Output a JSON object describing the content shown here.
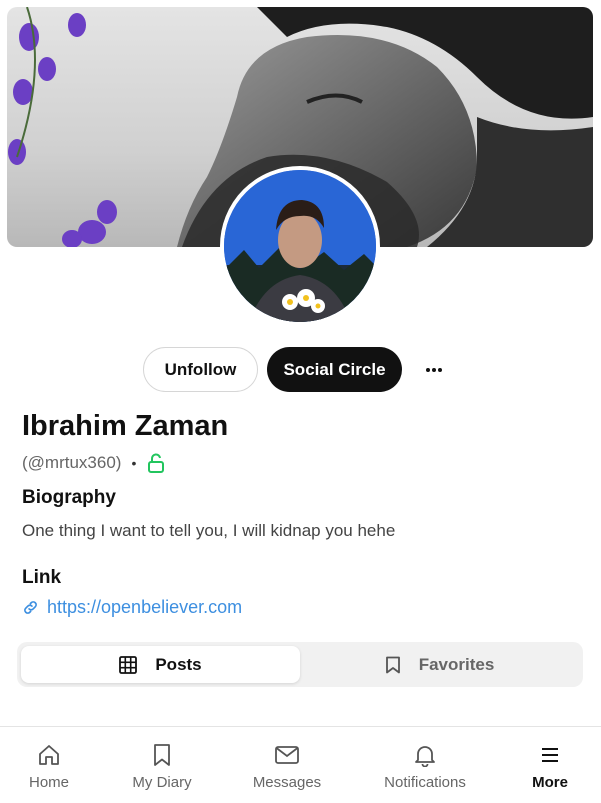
{
  "profile": {
    "name": "Ibrahim Zaman",
    "handle": "(@mrtux360)",
    "separator": "•",
    "bio_label": "Biography",
    "bio": "One thing I want to tell you, I will kidnap you hehe",
    "link_label": "Link",
    "link": "https://openbeliever.com"
  },
  "actions": {
    "unfollow": "Unfollow",
    "social_circle": "Social Circle",
    "more_icon": "ellipsis-icon"
  },
  "tabs": [
    {
      "label": "Posts",
      "icon": "grid-icon",
      "active": true
    },
    {
      "label": "Favorites",
      "icon": "bookmark-icon",
      "active": false
    }
  ],
  "nav": [
    {
      "label": "Home",
      "icon": "home-icon"
    },
    {
      "label": "My Diary",
      "icon": "bookmark-icon"
    },
    {
      "label": "Messages",
      "icon": "mail-icon"
    },
    {
      "label": "Notifications",
      "icon": "bell-icon"
    },
    {
      "label": "More",
      "icon": "menu-icon",
      "active": true
    }
  ],
  "colors": {
    "accent_link": "#3d8fe0",
    "lock_green": "#22c55e",
    "primary_dark": "#111111"
  }
}
